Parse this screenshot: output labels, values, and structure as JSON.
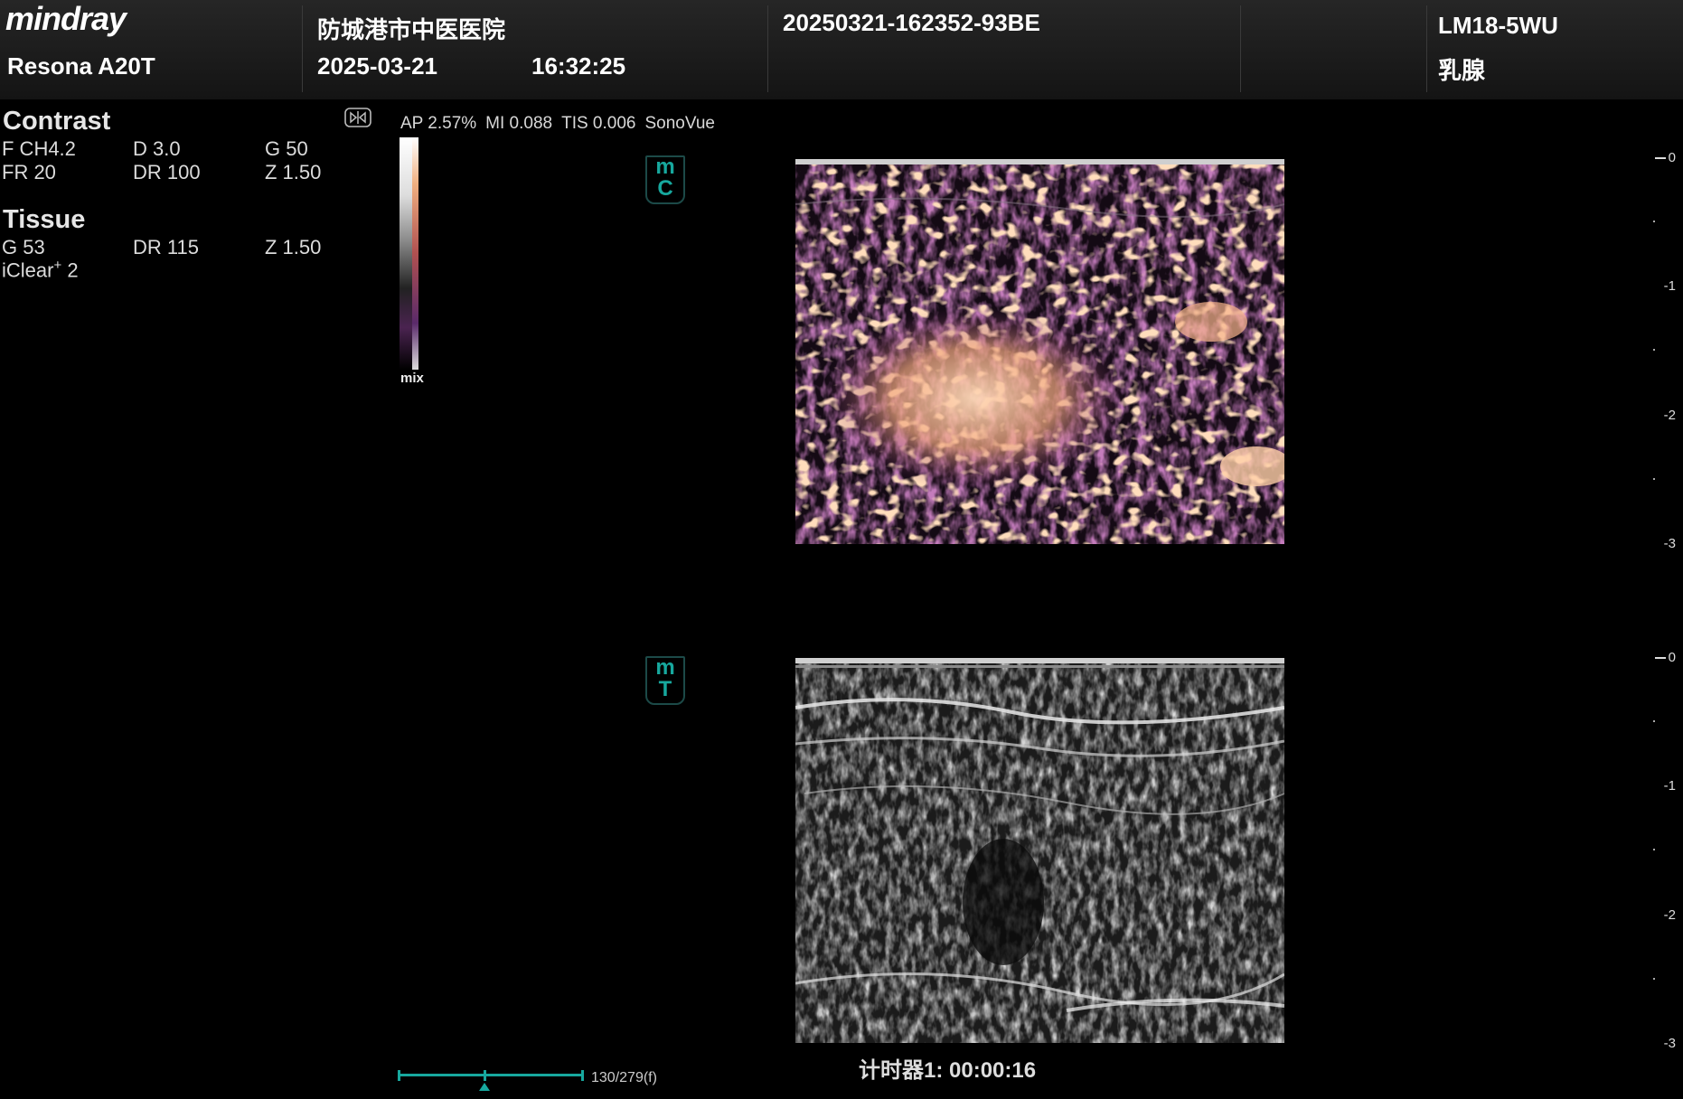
{
  "header": {
    "brand": "mindray",
    "model": "Resona A20T",
    "hospital": "防城港市中医医院",
    "date": "2025-03-21",
    "time": "16:32:25",
    "exam_id": "20250321-162352-93BE",
    "probe": "LM18-5WU",
    "exam_type": "乳腺"
  },
  "params": {
    "contrast": {
      "title": "Contrast",
      "f": "F CH4.2",
      "d": "D 3.0",
      "g": "G 50",
      "fr": "FR 20",
      "dr": "DR 100",
      "z": "Z 1.50"
    },
    "tissue": {
      "title": "Tissue",
      "g": "G 53",
      "dr": "DR 115",
      "z": "Z 1.50",
      "iclear_text": "iClear",
      "iclear_sup": "+",
      "iclear_val": " 2"
    }
  },
  "acoustic": {
    "ap": "AP 2.57%",
    "mi": "MI 0.088",
    "tis": "TIS 0.006",
    "agent": "SonoVue"
  },
  "colorbar": {
    "label": "mix"
  },
  "badges": {
    "contrast": {
      "top": "m",
      "bottom": "C"
    },
    "tissue": {
      "top": "m",
      "bottom": "T"
    }
  },
  "scale": {
    "labels": [
      "0",
      "1",
      "2",
      "3"
    ]
  },
  "cine": {
    "frame_text": "130/279(f)",
    "position": 0.465
  },
  "timer": "计时器1:  00:00:16",
  "colors": {
    "accent": "#17a89e",
    "background": "#000000"
  }
}
